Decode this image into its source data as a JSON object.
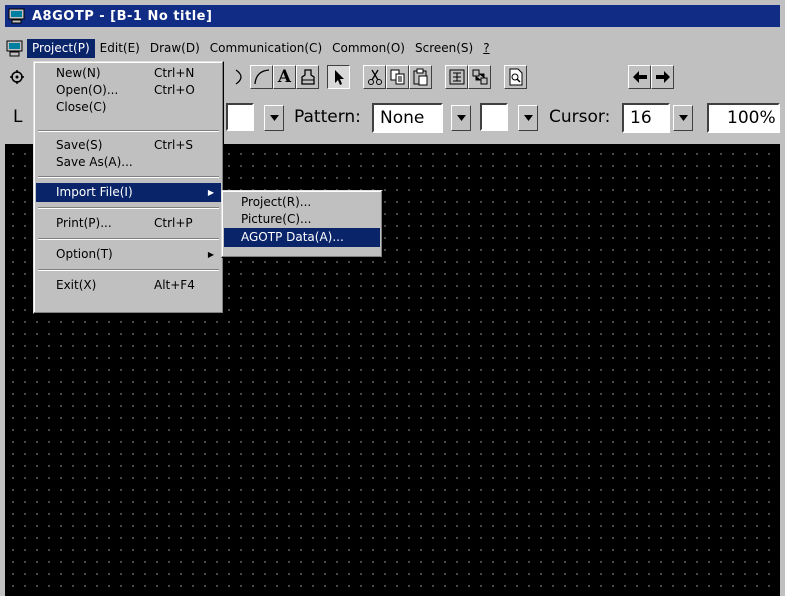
{
  "window": {
    "title": "A8GOTP - [B-1 No title]",
    "title_color": "#102c84"
  },
  "menubar": {
    "items": [
      {
        "label": "Project(P)",
        "active": true
      },
      {
        "label": "Edit(E)"
      },
      {
        "label": "Draw(D)"
      },
      {
        "label": "Communication(C)"
      },
      {
        "label": "Common(O)"
      },
      {
        "label": "Screen(S)"
      },
      {
        "label": "?"
      }
    ],
    "highlight_color": "#0a246a"
  },
  "project_menu": {
    "new": {
      "label": "New(N)",
      "shortcut": "Ctrl+N"
    },
    "open": {
      "label": "Open(O)...",
      "shortcut": "Ctrl+O"
    },
    "close": {
      "label": "Close(C)"
    },
    "save": {
      "label": "Save(S)",
      "shortcut": "Ctrl+S"
    },
    "save_as": {
      "label": "Save As(A)..."
    },
    "import_file": {
      "label": "Import File(I)",
      "highlighted": true
    },
    "print": {
      "label": "Print(P)...",
      "shortcut": "Ctrl+P"
    },
    "option": {
      "label": "Option(T)"
    },
    "exit": {
      "label": "Exit(X)",
      "shortcut": "Alt+F4"
    }
  },
  "import_submenu": {
    "project": {
      "label": "Project(R)..."
    },
    "picture": {
      "label": "Picture(C)..."
    },
    "agotp_data": {
      "label": "AGOTP Data(A)...",
      "highlighted": true
    }
  },
  "toolbar": {
    "tools": [
      "ellipse-tool-icon",
      "arc-tool-icon",
      "text-tool-icon",
      "paint-tool-icon",
      "select-pointer-icon",
      "cut-icon",
      "copy-icon",
      "paste-icon",
      "group-icon",
      "ungroup-icon",
      "preview-icon",
      "arrow-left-icon",
      "arrow-right-icon"
    ],
    "pattern_label": "Pattern:",
    "pattern_value": "None",
    "cursor_label": "Cursor:",
    "cursor_value": "16",
    "zoom": "100%",
    "left_fragment": "L"
  },
  "canvas": {
    "background": "#000000",
    "grid": true
  }
}
